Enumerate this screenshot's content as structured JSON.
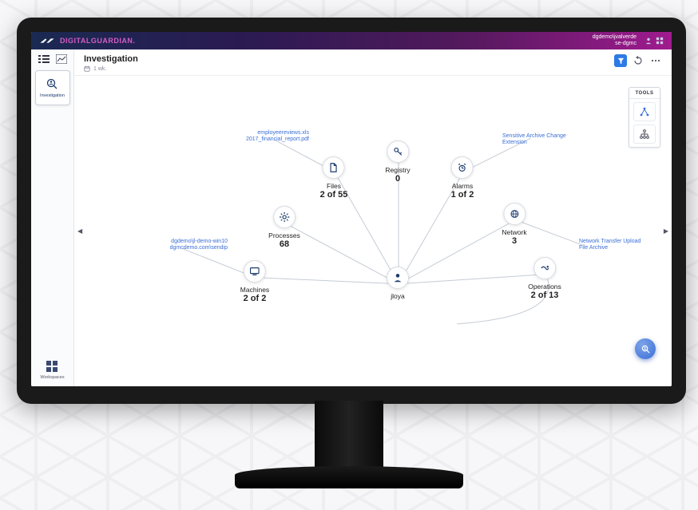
{
  "brand": {
    "primary": "DIGITAL",
    "accent": "GUARDIAN."
  },
  "user": {
    "line1": "dgdemo\\jvalverde",
    "line2": "se-dgmc"
  },
  "sidebar": {
    "card_label": "Investigation",
    "workspaces_label": "Workspaces"
  },
  "header": {
    "title": "Investigation",
    "range": "1 wk."
  },
  "tools": {
    "title": "TOOLS"
  },
  "annotations": {
    "files_note": "employeereviews.xls\n2017_financial_report.pdf",
    "alarms_note": "Sensitive Archive Change Extension",
    "machines_note": "dgdemo\\jl-demo-win10\ndgmcdemo.com\\sendip",
    "network_note": "Network Transfer Upload File Archive"
  },
  "nodes": {
    "center": {
      "label": "jloya",
      "value": ""
    },
    "machines": {
      "label": "Machines",
      "value": "2 of 2"
    },
    "processes": {
      "label": "Processes",
      "value": "68"
    },
    "files": {
      "label": "Files",
      "value": "2 of 55"
    },
    "registry": {
      "label": "Registry",
      "value": "0"
    },
    "alarms": {
      "label": "Alarms",
      "value": "1 of 2"
    },
    "network": {
      "label": "Network",
      "value": "3"
    },
    "operations": {
      "label": "Operations",
      "value": "2 of 13"
    }
  }
}
